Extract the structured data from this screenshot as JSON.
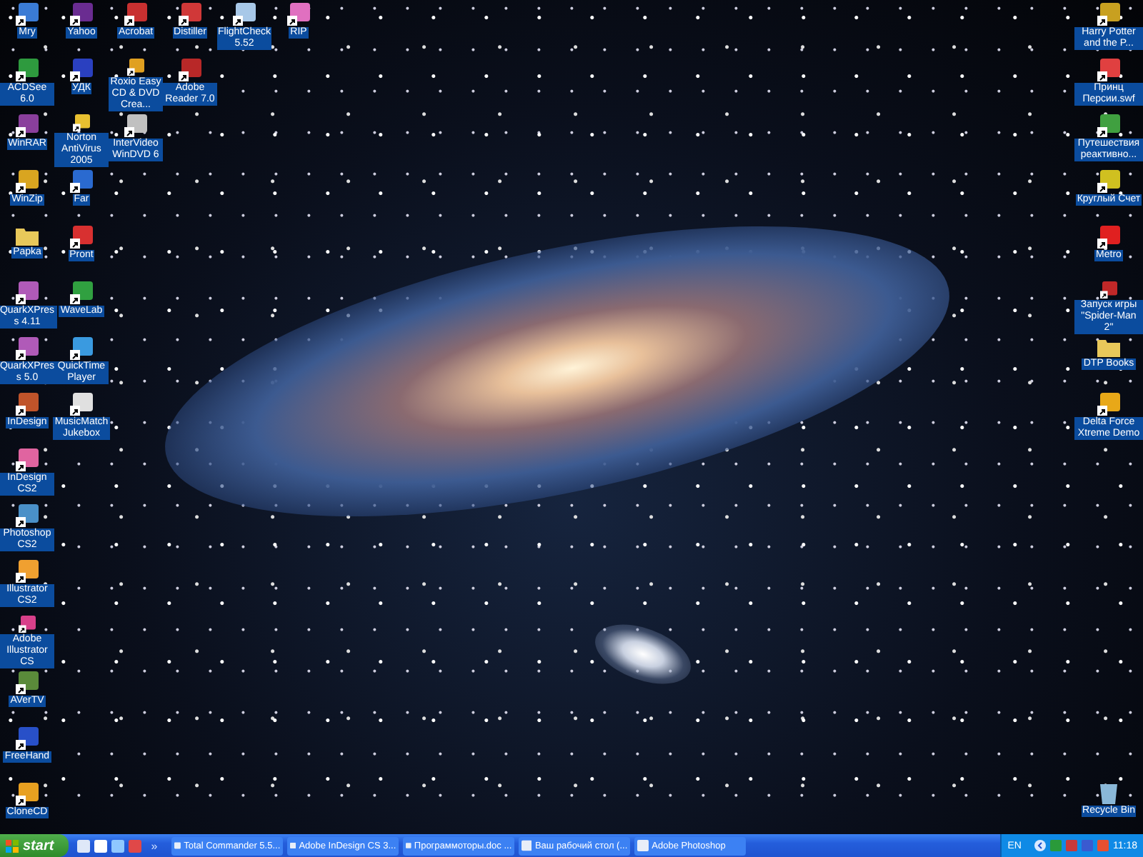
{
  "desktop": {
    "left_columns": [
      {
        "icons": [
          {
            "label": "Mry",
            "kind": "app",
            "color": "#3a7bd5"
          },
          {
            "label": "ACDSee 6.0",
            "kind": "app",
            "color": "#2e9a3e"
          },
          {
            "label": "WinRAR",
            "kind": "app",
            "color": "#8a3f9c"
          },
          {
            "label": "WinZip",
            "kind": "app",
            "color": "#d9a520"
          },
          {
            "label": "Papka",
            "kind": "folder",
            "color": "#e8c85a"
          },
          {
            "label": "QuarkXPress 4.11",
            "kind": "app",
            "color": "#b05ab8"
          },
          {
            "label": "QuarkXPress 5.0",
            "kind": "app",
            "color": "#b05ab8"
          },
          {
            "label": "InDesign",
            "kind": "app",
            "color": "#c0542a"
          },
          {
            "label": "InDesign CS2",
            "kind": "app",
            "color": "#e064a0"
          },
          {
            "label": "Photoshop CS2",
            "kind": "app",
            "color": "#4a90c8"
          },
          {
            "label": "Illustrator CS2",
            "kind": "app",
            "color": "#f0a030"
          },
          {
            "label": "Adobe Illustrator CS",
            "kind": "app",
            "color": "#d8408a"
          },
          {
            "label": "AVerTV",
            "kind": "app",
            "color": "#5a8a3a"
          },
          {
            "label": "FreeHand",
            "kind": "app",
            "color": "#2850c8"
          },
          {
            "label": "CloneCD",
            "kind": "app",
            "color": "#e8a020"
          }
        ]
      },
      {
        "icons": [
          {
            "label": "Yahoo",
            "kind": "app",
            "color": "#6a2c91"
          },
          {
            "label": "УДК",
            "kind": "app",
            "color": "#2a40c0"
          },
          {
            "label": "Norton AntiVirus 2005",
            "kind": "app",
            "color": "#e8c030"
          },
          {
            "label": "Far",
            "kind": "app",
            "color": "#2a6ad0"
          },
          {
            "label": "Pront",
            "kind": "app",
            "color": "#d83030"
          },
          {
            "label": "WaveLab",
            "kind": "app",
            "color": "#30a040"
          },
          {
            "label": "QuickTime Player",
            "kind": "app",
            "color": "#3a9ae0"
          },
          {
            "label": "MusicMatch Jukebox",
            "kind": "app",
            "color": "#e0e0e0"
          }
        ]
      },
      {
        "icons": [
          {
            "label": "Acrobat",
            "kind": "app",
            "color": "#c83030"
          },
          {
            "label": "Roxio Easy CD & DVD Crea...",
            "kind": "app",
            "color": "#e0a020"
          },
          {
            "label": "InterVideo WinDVD 6",
            "kind": "app",
            "color": "#c0c0c0"
          }
        ]
      },
      {
        "icons": [
          {
            "label": "Distiller",
            "kind": "app",
            "color": "#d03838"
          },
          {
            "label": "Adobe Reader 7.0",
            "kind": "app",
            "color": "#b82828"
          }
        ]
      },
      {
        "icons": [
          {
            "label": "FlightCheck 5.52",
            "kind": "app",
            "color": "#a8c8e8"
          }
        ]
      },
      {
        "icons": [
          {
            "label": "RIP",
            "kind": "app",
            "color": "#e070c0"
          }
        ]
      }
    ],
    "right_column": {
      "icons": [
        {
          "label": "Harry Potter and the P...",
          "kind": "app",
          "color": "#c8a020"
        },
        {
          "label": "Принц Персии.swf",
          "kind": "app",
          "color": "#e04040"
        },
        {
          "label": "Путешествия реактивно...",
          "kind": "app",
          "color": "#40a040"
        },
        {
          "label": "Круглый Счет",
          "kind": "app",
          "color": "#d0c020"
        },
        {
          "label": "Metro",
          "kind": "app",
          "color": "#e02020"
        },
        {
          "label": "Запуск игры \"Spider-Man 2\"",
          "kind": "app",
          "color": "#c02828"
        },
        {
          "label": "DTP Books",
          "kind": "folder",
          "color": "#e8c85a"
        },
        {
          "label": "Delta Force Xtreme Demo",
          "kind": "app",
          "color": "#e8a818"
        }
      ]
    },
    "recycle_bin": {
      "label": "Recycle Bin",
      "kind": "trash",
      "color": "#8ab8d8"
    }
  },
  "taskbar": {
    "start": "start",
    "quick_launch_more": "»",
    "tasks": [
      {
        "label": "Total Commander 5.5...",
        "selected": false
      },
      {
        "label": "Adobe InDesign CS 3...",
        "selected": false
      },
      {
        "label": "Программоторы.doc ...",
        "selected": false
      },
      {
        "label": "Ваш рабочий стол (...",
        "selected": false
      },
      {
        "label": "Adobe Photoshop",
        "selected": false
      }
    ],
    "language": "EN",
    "clock": "11:18"
  }
}
